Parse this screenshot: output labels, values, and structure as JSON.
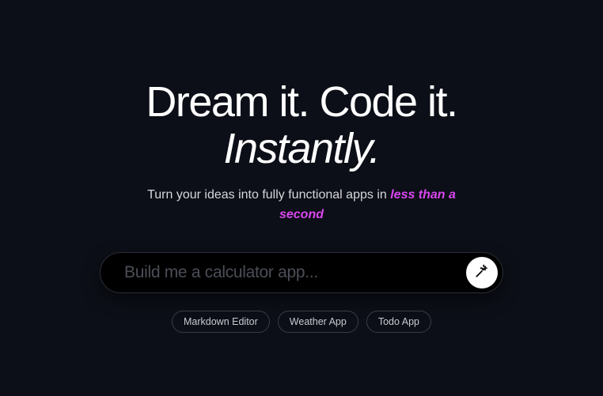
{
  "hero": {
    "headline_line1": "Dream it. Code it.",
    "headline_line2": "Instantly.",
    "subline_prefix": "Turn your ideas into fully functional apps in ",
    "subline_highlight": "less than a second"
  },
  "input": {
    "placeholder": "Build me a calculator app..."
  },
  "chips": {
    "0": "Markdown Editor",
    "1": "Weather App",
    "2": "Todo App"
  }
}
